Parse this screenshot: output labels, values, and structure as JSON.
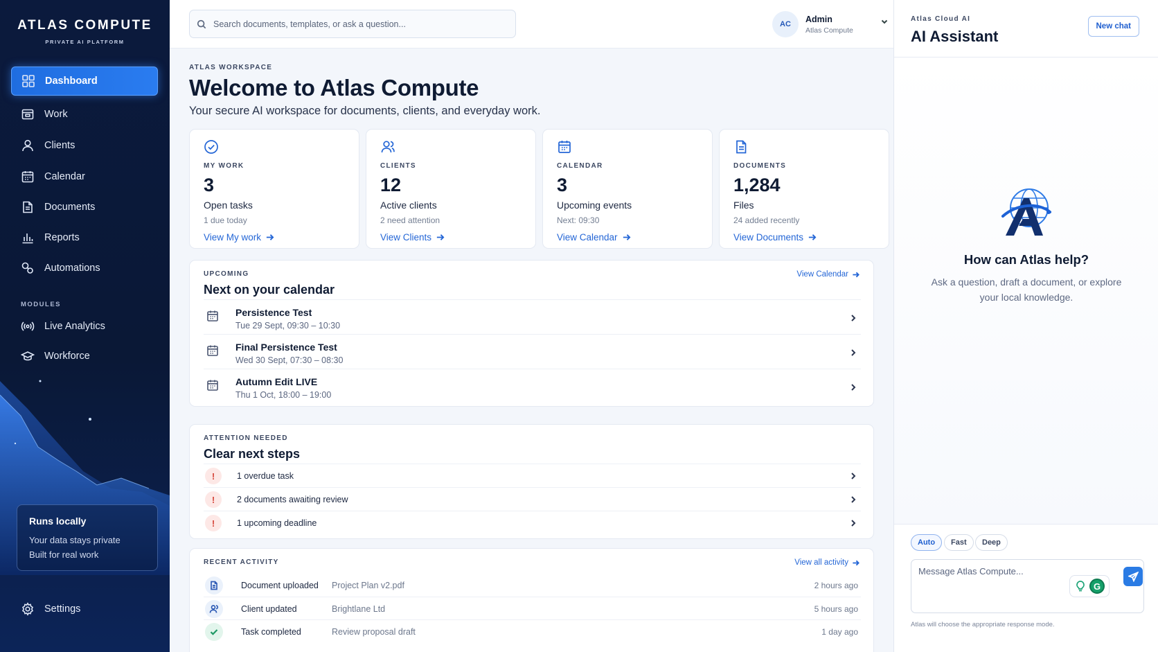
{
  "brand": {
    "name": "ATLAS COMPUTE",
    "tagline": "PRIVATE AI PLATFORM"
  },
  "nav": {
    "items": [
      {
        "label": "Dashboard",
        "icon": "grid-icon",
        "active": true
      },
      {
        "label": "Work",
        "icon": "folder-icon"
      },
      {
        "label": "Clients",
        "icon": "users-icon"
      },
      {
        "label": "Calendar",
        "icon": "calendar-icon"
      },
      {
        "label": "Documents",
        "icon": "document-icon"
      },
      {
        "label": "Reports",
        "icon": "bar-chart-icon"
      },
      {
        "label": "Automations",
        "icon": "automation-icon"
      }
    ],
    "modules_label": "MODULES",
    "modules": [
      {
        "label": "Live Analytics",
        "icon": "broadcast-icon"
      },
      {
        "label": "Workforce",
        "icon": "graduation-cap-icon"
      }
    ],
    "settings_label": "Settings"
  },
  "runs_locally": {
    "title": "Runs locally",
    "line1": "Your data stays private",
    "line2": "Built for real work"
  },
  "search": {
    "placeholder": "Search documents, templates, or ask a question..."
  },
  "user": {
    "initials": "AC",
    "name": "Admin",
    "org": "Atlas Compute"
  },
  "workspace": {
    "eyebrow": "ATLAS WORKSPACE",
    "title": "Welcome to Atlas Compute",
    "subtitle": "Your secure AI workspace for documents, clients, and everyday work."
  },
  "stats": [
    {
      "label": "MY WORK",
      "value": "3",
      "desc": "Open tasks",
      "note": "1 due today",
      "link": "View My work",
      "icon": "check-circle-icon"
    },
    {
      "label": "CLIENTS",
      "value": "12",
      "desc": "Active clients",
      "note": "2 need attention",
      "link": "View Clients",
      "icon": "users-icon"
    },
    {
      "label": "CALENDAR",
      "value": "3",
      "desc": "Upcoming events",
      "note": "Next: 09:30",
      "link": "View Calendar",
      "icon": "calendar-icon"
    },
    {
      "label": "DOCUMENTS",
      "value": "1,284",
      "desc": "Files",
      "note": "24 added recently",
      "link": "View Documents",
      "icon": "document-icon"
    }
  ],
  "upcoming": {
    "eyebrow": "UPCOMING",
    "title": "Next on your calendar",
    "link": "View Calendar",
    "events": [
      {
        "title": "Persistence Test",
        "time": "Tue 29 Sept, 09:30 – 10:30"
      },
      {
        "title": "Final Persistence Test",
        "time": "Wed 30 Sept, 07:30 – 08:30"
      },
      {
        "title": "Autumn Edit LIVE",
        "time": "Thu 1 Oct, 18:00 – 19:00"
      }
    ]
  },
  "attention": {
    "eyebrow": "ATTENTION NEEDED",
    "title": "Clear next steps",
    "items": [
      {
        "text": "1 overdue task"
      },
      {
        "text": "2 documents awaiting review"
      },
      {
        "text": "1 upcoming deadline"
      }
    ]
  },
  "activity": {
    "eyebrow": "RECENT ACTIVITY",
    "link": "View all activity",
    "items": [
      {
        "action": "Document uploaded",
        "object": "Project Plan v2.pdf",
        "when": "2 hours ago",
        "icon": "document-icon"
      },
      {
        "action": "Client updated",
        "object": "Brightlane Ltd",
        "when": "5 hours ago",
        "icon": "user-icon"
      },
      {
        "action": "Task completed",
        "object": "Review proposal draft",
        "when": "1 day ago",
        "icon": "check-icon"
      }
    ]
  },
  "assistant": {
    "eyebrow": "Atlas Cloud AI",
    "title": "AI Assistant",
    "new_chat": "New chat",
    "help_title": "How can Atlas help?",
    "help_desc": "Ask a question, draft a document, or explore your local knowledge.",
    "modes": [
      "Auto",
      "Fast",
      "Deep"
    ],
    "active_mode": "Auto",
    "message_placeholder": "Message Atlas Compute...",
    "extension_letter": "G",
    "footer": "Atlas will choose the appropriate response mode."
  },
  "colors": {
    "accent": "#2466d6",
    "sidebar": "#0b1a3d",
    "alert": "#d6453a",
    "success": "#1f9a66"
  }
}
